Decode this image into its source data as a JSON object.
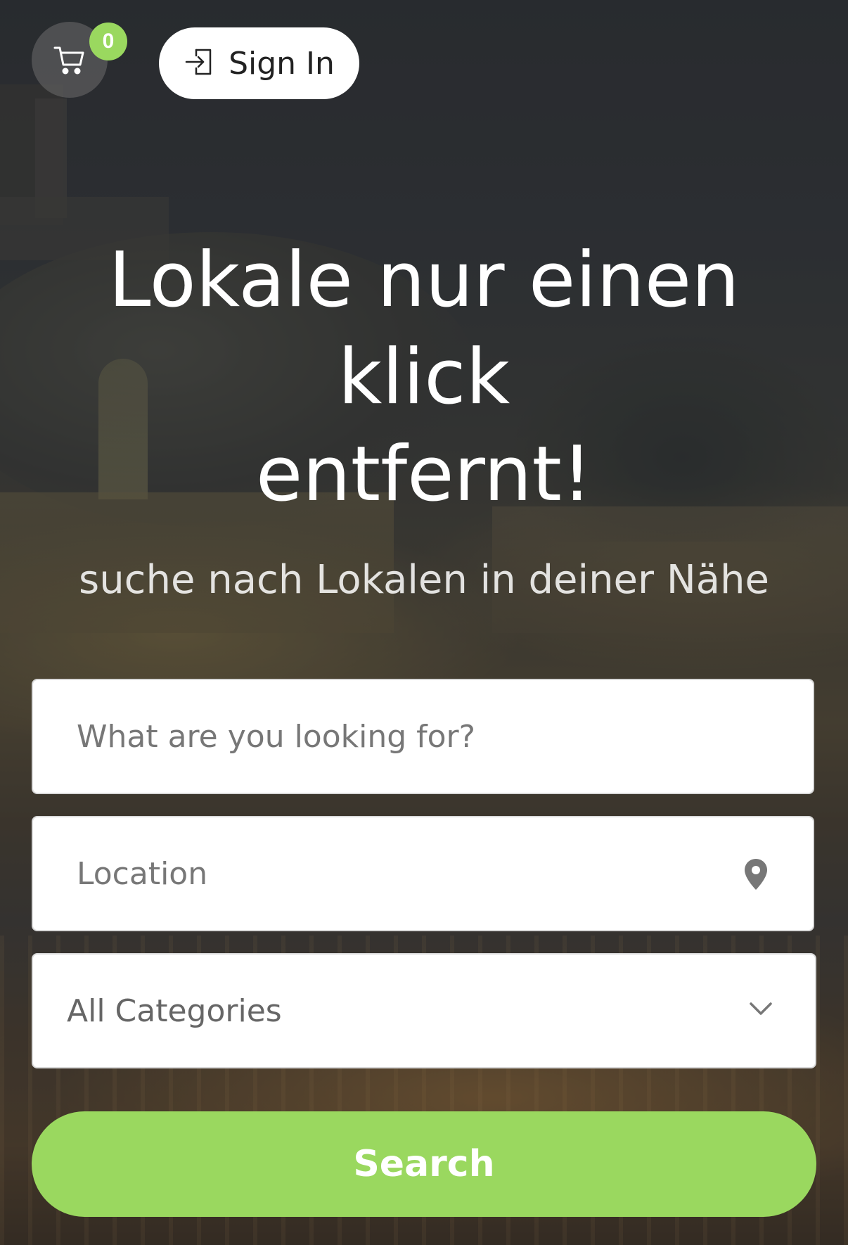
{
  "header": {
    "cart": {
      "icon": "shopping-cart-icon",
      "count": "0",
      "badge_color": "#9ad85f"
    },
    "sign_in": {
      "icon": "sign-in-icon",
      "label": "Sign In"
    }
  },
  "hero": {
    "title_lines": [
      "Lokale nur einen",
      "klick",
      "entfernt!"
    ],
    "subtitle": "suche nach Lokalen in deiner Nähe"
  },
  "search_form": {
    "keyword": {
      "placeholder": "What are you looking for?",
      "value": ""
    },
    "location": {
      "placeholder": "Location",
      "value": "",
      "icon": "map-pin-icon"
    },
    "category": {
      "selected": "All Categories",
      "icon": "chevron-down-icon"
    },
    "submit_label": "Search",
    "accent_color": "#9ad85f"
  }
}
